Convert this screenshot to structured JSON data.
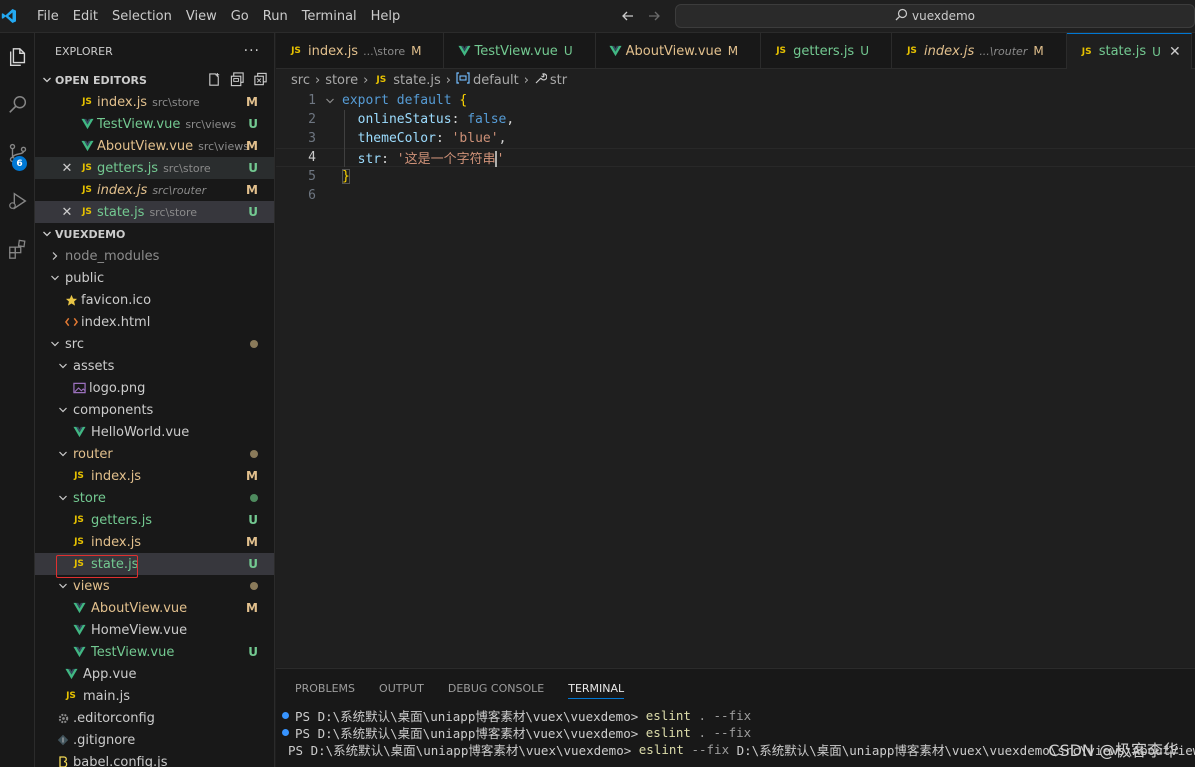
{
  "titlebar": {
    "menu": [
      "File",
      "Edit",
      "Selection",
      "View",
      "Go",
      "Run",
      "Terminal",
      "Help"
    ],
    "command_center": "vuexdemo"
  },
  "activitybar": {
    "items": [
      "explorer-icon",
      "search-icon",
      "source-control-icon",
      "run-debug-icon",
      "extensions-icon"
    ],
    "source_control_badge": "6"
  },
  "sidebar": {
    "title": "EXPLORER",
    "more": "···",
    "open_editors": {
      "header": "OPEN EDITORS",
      "items": [
        {
          "name": "index.js",
          "path": "src\\store",
          "status": "M",
          "type": "js",
          "color": "mod",
          "italic": false,
          "close": false
        },
        {
          "name": "TestView.vue",
          "path": "src\\views",
          "status": "U",
          "type": "vue",
          "color": "new",
          "italic": false,
          "close": false
        },
        {
          "name": "AboutView.vue",
          "path": "src\\views",
          "status": "M",
          "type": "vue",
          "color": "mod",
          "italic": false,
          "close": false
        },
        {
          "name": "getters.js",
          "path": "src\\store",
          "status": "U",
          "type": "js",
          "color": "new",
          "italic": false,
          "close": true
        },
        {
          "name": "index.js",
          "path": "src\\router",
          "status": "M",
          "type": "js",
          "color": "mod",
          "italic": true,
          "close": false
        },
        {
          "name": "state.js",
          "path": "src\\store",
          "status": "U",
          "type": "js",
          "color": "new",
          "italic": false,
          "close": true
        }
      ]
    },
    "project": {
      "header": "VUEXDEMO",
      "items": [
        {
          "name": "node_modules",
          "level": 1,
          "kind": "folder-closed",
          "color": "ign"
        },
        {
          "name": "public",
          "level": 1,
          "kind": "folder-open",
          "color": "plain"
        },
        {
          "name": "favicon.ico",
          "level": 2,
          "kind": "star",
          "color": "plain"
        },
        {
          "name": "index.html",
          "level": 2,
          "kind": "html",
          "color": "plain"
        },
        {
          "name": "src",
          "level": 1,
          "kind": "folder-open",
          "color": "plain",
          "dot": "#8a7a5a"
        },
        {
          "name": "assets",
          "level": 2,
          "kind": "folder-open",
          "color": "plain"
        },
        {
          "name": "logo.png",
          "level": 3,
          "kind": "image",
          "color": "plain"
        },
        {
          "name": "components",
          "level": 2,
          "kind": "folder-open",
          "color": "plain"
        },
        {
          "name": "HelloWorld.vue",
          "level": 3,
          "kind": "vue",
          "color": "plain"
        },
        {
          "name": "router",
          "level": 2,
          "kind": "folder-open",
          "color": "mod",
          "dot": "#8a7a5a"
        },
        {
          "name": "index.js",
          "level": 3,
          "kind": "js",
          "color": "mod",
          "status": "M"
        },
        {
          "name": "store",
          "level": 2,
          "kind": "folder-open",
          "color": "new",
          "dot": "#4e8a5e"
        },
        {
          "name": "getters.js",
          "level": 3,
          "kind": "js",
          "color": "new",
          "status": "U"
        },
        {
          "name": "index.js",
          "level": 3,
          "kind": "js",
          "color": "mod",
          "status": "M"
        },
        {
          "name": "state.js",
          "level": 3,
          "kind": "js",
          "color": "new",
          "status": "U",
          "selected": true
        },
        {
          "name": "views",
          "level": 2,
          "kind": "folder-open",
          "color": "mod",
          "dot": "#8a7a5a"
        },
        {
          "name": "AboutView.vue",
          "level": 3,
          "kind": "vue",
          "color": "mod",
          "status": "M"
        },
        {
          "name": "HomeView.vue",
          "level": 3,
          "kind": "vue",
          "color": "plain"
        },
        {
          "name": "TestView.vue",
          "level": 3,
          "kind": "vue",
          "color": "new",
          "status": "U"
        },
        {
          "name": "App.vue",
          "level": 2,
          "kind": "vue",
          "color": "plain"
        },
        {
          "name": "main.js",
          "level": 2,
          "kind": "js",
          "color": "plain"
        },
        {
          "name": ".editorconfig",
          "level": 1,
          "kind": "gear",
          "color": "plain"
        },
        {
          "name": ".gitignore",
          "level": 1,
          "kind": "git",
          "color": "plain"
        },
        {
          "name": "babel.config.js",
          "level": 1,
          "kind": "babel",
          "color": "plain"
        }
      ]
    }
  },
  "tabs": [
    {
      "name": "index.js",
      "desc": "...\\store",
      "status": "M",
      "type": "js",
      "color": "mod",
      "italic": false,
      "active": false
    },
    {
      "name": "TestView.vue",
      "desc": "",
      "status": "U",
      "type": "vue",
      "color": "new",
      "italic": false,
      "active": false
    },
    {
      "name": "AboutView.vue",
      "desc": "",
      "status": "M",
      "type": "vue",
      "color": "mod",
      "italic": false,
      "active": false
    },
    {
      "name": "getters.js",
      "desc": "",
      "status": "U",
      "type": "js",
      "color": "new",
      "italic": false,
      "active": false
    },
    {
      "name": "index.js",
      "desc": "...\\router",
      "status": "M",
      "type": "js",
      "color": "mod",
      "italic": true,
      "active": false
    },
    {
      "name": "state.js",
      "desc": "",
      "status": "U",
      "type": "js",
      "color": "new",
      "italic": false,
      "active": true
    }
  ],
  "breadcrumb": [
    "src",
    "store",
    "state.js",
    "default",
    "str"
  ],
  "editor": {
    "lines": [
      "1",
      "2",
      "3",
      "4",
      "5",
      "6"
    ],
    "current_line": 4,
    "code": {
      "l1_kw1": "export",
      "l1_kw2": "default",
      "l1_brace": "{",
      "l2_prop": "onlineStatus",
      "l2_val": "false",
      "l3_prop": "themeColor",
      "l3_val": "'blue'",
      "l4_prop": "str",
      "l4_val_a": "'这是一个字符串",
      "l4_val_b": "'",
      "l5_brace": "}"
    }
  },
  "panel": {
    "tabs": [
      "PROBLEMS",
      "OUTPUT",
      "DEBUG CONSOLE",
      "TERMINAL"
    ],
    "active_tab": "TERMINAL",
    "terminal_lines": [
      {
        "prompt": "PS D:\\系统默认\\桌面\\uniapp博客素材\\vuex\\vuexdemo> ",
        "cmd": "eslint",
        "args": " . --fix",
        "extra": ""
      },
      {
        "prompt": "PS D:\\系统默认\\桌面\\uniapp博客素材\\vuex\\vuexdemo> ",
        "cmd": "eslint",
        "args": " . --fix",
        "extra": ""
      },
      {
        "prompt": "PS D:\\系统默认\\桌面\\uniapp博客素材\\vuex\\vuexdemo> ",
        "cmd": "eslint",
        "args": " --fix ",
        "extra": "D:\\系统默认\\桌面\\uniapp博客素材\\vuex\\vuexdemo\\src\\views\\AboutView"
      }
    ]
  },
  "watermark": "CSDN @极客李华",
  "colors": {
    "modified": "#e2c08d",
    "untracked": "#73c991",
    "accent": "#0078d4",
    "highlight_box": "#e03030"
  }
}
